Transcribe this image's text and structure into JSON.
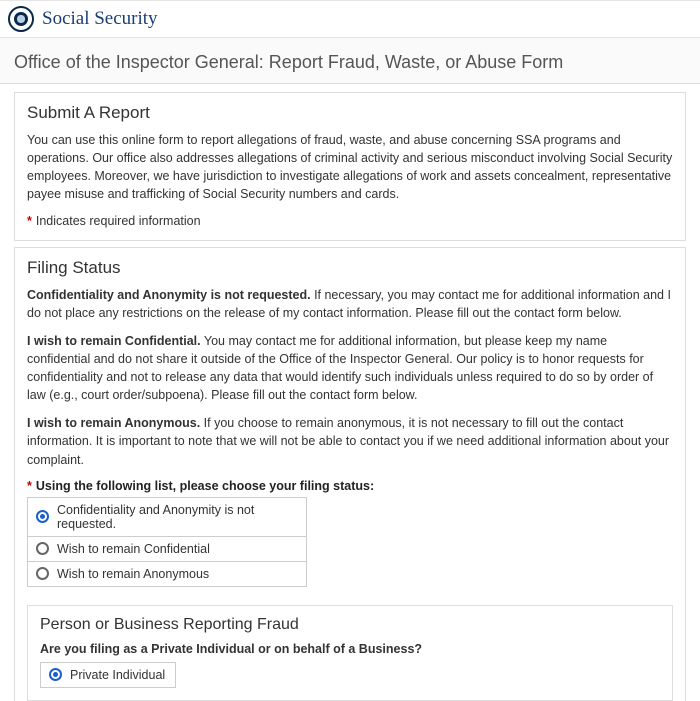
{
  "brand": "Social Security",
  "page_title": "Office of the Inspector General: Report Fraud, Waste, or Abuse Form",
  "submit": {
    "heading": "Submit A Report",
    "body": "You can use this online form to report allegations of fraud, waste, and abuse concerning SSA programs and operations. Our office also addresses allegations of criminal activity and serious misconduct involving Social Security employees. Moreover, we have jurisdiction to investigate allegations of work and assets concealment, representative payee misuse and trafficking of Social Security numbers and cards.",
    "req_mark": "*",
    "req_note": "Indicates required information"
  },
  "filing": {
    "heading": "Filing Status",
    "opt1_label": "Confidentiality and Anonymity is not requested.",
    "opt1_body": " If necessary, you may contact me for additional information and I do not place any restrictions on the release of my contact information. Please fill out the contact form below.",
    "opt2_label": "I wish to remain Confidential.",
    "opt2_body": " You may contact me for additional information, but please keep my name confidential and do not share it outside of the Office of the Inspector General. Our policy is to honor requests for confidentiality and not to release any data that would identify such individuals unless required to do so by order of law (e.g., court order/subpoena). Please fill out the contact form below.",
    "opt3_label": "I wish to remain Anonymous.",
    "opt3_body": " If you choose to remain anonymous, it is not necessary to fill out the contact information. It is important to note that we will not be able to contact you if we need additional information about your complaint.",
    "prompt_req": "*",
    "prompt": "Using the following list, please choose your filing status:",
    "options": [
      "Confidentiality and Anonymity is not requested.",
      "Wish to remain Confidential",
      "Wish to remain Anonymous"
    ]
  },
  "reporter": {
    "heading": "Person or Business Reporting Fraud",
    "question": "Are you filing as a Private Individual or on behalf of a Business?",
    "opt1": "Private Individual"
  }
}
